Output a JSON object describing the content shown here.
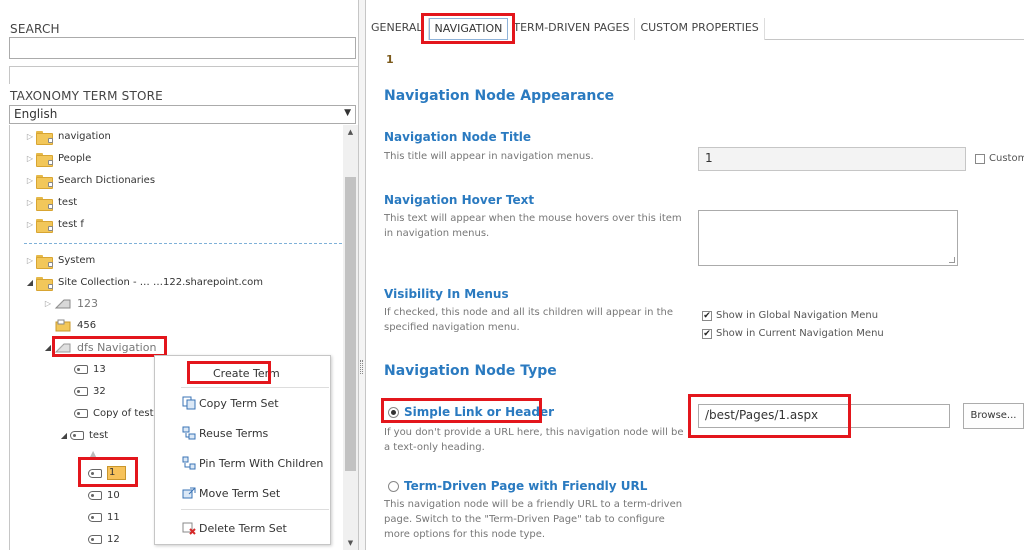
{
  "left": {
    "search_label": "SEARCH",
    "search_value": "",
    "store_label": "TAXONOMY TERM STORE",
    "language": "English",
    "tree": [
      {
        "label": "navigation"
      },
      {
        "label": "People"
      },
      {
        "label": "Search Dictionaries"
      },
      {
        "label": "test"
      },
      {
        "label": "test f"
      },
      {
        "label": "System"
      },
      {
        "label": "Site Collection - … …122.sharepoint.com"
      },
      {
        "label": "123"
      },
      {
        "label": "456"
      },
      {
        "label": "dfs Navigation"
      },
      {
        "label": "13"
      },
      {
        "label": "32"
      },
      {
        "label": "Copy of test"
      },
      {
        "label": "test"
      },
      {
        "label": "1"
      },
      {
        "label": "10"
      },
      {
        "label": "11"
      },
      {
        "label": "12"
      }
    ],
    "context_menu": [
      {
        "label": "Create Term",
        "icon": "none"
      },
      {
        "label": "Copy Term Set",
        "icon": "copy-icon"
      },
      {
        "label": "Reuse Terms",
        "icon": "reuse-icon"
      },
      {
        "label": "Pin Term With Children",
        "icon": "pin-icon"
      },
      {
        "label": "Move Term Set",
        "icon": "move-icon"
      },
      {
        "label": "Delete Term Set",
        "icon": "delete-icon"
      }
    ]
  },
  "right": {
    "tabs": [
      {
        "label": "GENERAL"
      },
      {
        "label": "NAVIGATION"
      },
      {
        "label": "TERM-DRIVEN PAGES"
      },
      {
        "label": "CUSTOM PROPERTIES"
      }
    ],
    "term_name": "1",
    "appearance_heading": "Navigation Node Appearance",
    "title_label": "Navigation Node Title",
    "title_desc": "This title will appear in navigation menus.",
    "title_value": "1",
    "custom_label": "Custom",
    "hover_label": "Navigation Hover Text",
    "hover_desc_1": "This text will appear when the mouse hovers over this item",
    "hover_desc_2": "in navigation menus.",
    "hover_value": "",
    "visibility_label": "Visibility In Menus",
    "visibility_desc_1": "If checked, this node and all its children will appear in the",
    "visibility_desc_2": "specified navigation menu.",
    "global_nav": "Show in Global Navigation Menu",
    "current_nav": "Show in Current Navigation Menu",
    "type_heading": "Navigation Node Type",
    "simple_link_label": "Simple Link or Header",
    "simple_link_desc_1": "If you don't provide a URL here, this navigation node will be",
    "simple_link_desc_2": "a text-only heading.",
    "url_value": "/best/Pages/1.aspx",
    "browse_label": "Browse...",
    "term_driven_label": "Term-Driven Page with Friendly URL",
    "term_driven_desc_1": "This navigation node will be a friendly URL to a term-driven",
    "term_driven_desc_2": "page. Switch to the \"Term-Driven Page\" tab to configure",
    "term_driven_desc_3": "more options for this node type."
  },
  "colors": {
    "accent_blue": "#2a7ac0",
    "highlight_red": "#e3161c",
    "folder_yellow": "#f2c75a"
  }
}
